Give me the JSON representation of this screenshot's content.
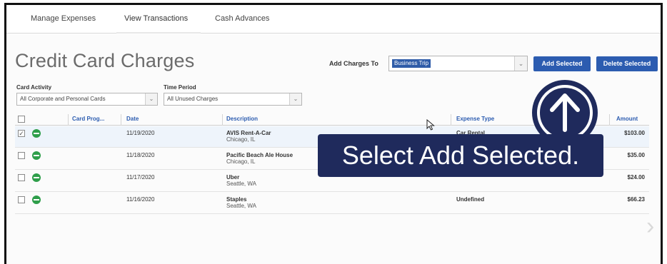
{
  "nav": {
    "tabs": [
      {
        "label": "Manage Expenses"
      },
      {
        "label": "View Transactions"
      },
      {
        "label": "Cash Advances"
      }
    ]
  },
  "page": {
    "title": "Credit Card Charges"
  },
  "add_to": {
    "label": "Add Charges To",
    "selected": "Business Trip",
    "add_button": "Add Selected",
    "delete_button": "Delete Selected"
  },
  "filters": {
    "card_activity_label": "Card Activity",
    "card_activity_value": "All Corporate and Personal Cards",
    "time_period_label": "Time Period",
    "time_period_value": "All Unused Charges"
  },
  "table": {
    "headers": {
      "card_program": "Card Prog...",
      "date": "Date",
      "description": "Description",
      "expense_type": "Expense Type",
      "amount": "Amount"
    },
    "rows": [
      {
        "checked": "✓",
        "date": "11/19/2020",
        "merchant": "AVIS Rent-A-Car",
        "location": "Chicago, IL",
        "expense_type": "Car Rental",
        "amount": "$103.00"
      },
      {
        "checked": "",
        "date": "11/18/2020",
        "merchant": "Pacific Beach Ale House",
        "location": "Chicago, IL",
        "expense_type": "",
        "amount": "$35.00"
      },
      {
        "checked": "",
        "date": "11/17/2020",
        "merchant": "Uber",
        "location": "Seattle, WA",
        "expense_type": "",
        "amount": "$24.00"
      },
      {
        "checked": "",
        "date": "11/16/2020",
        "merchant": "Staples",
        "location": "Seattle, WA",
        "expense_type": "Undefined",
        "amount": "$66.23"
      }
    ]
  },
  "callout": {
    "text": "Select Add Selected."
  },
  "colors": {
    "accent": "#2c5cb0",
    "callout": "#1f2a5c",
    "status_green": "#2e9e4a"
  }
}
